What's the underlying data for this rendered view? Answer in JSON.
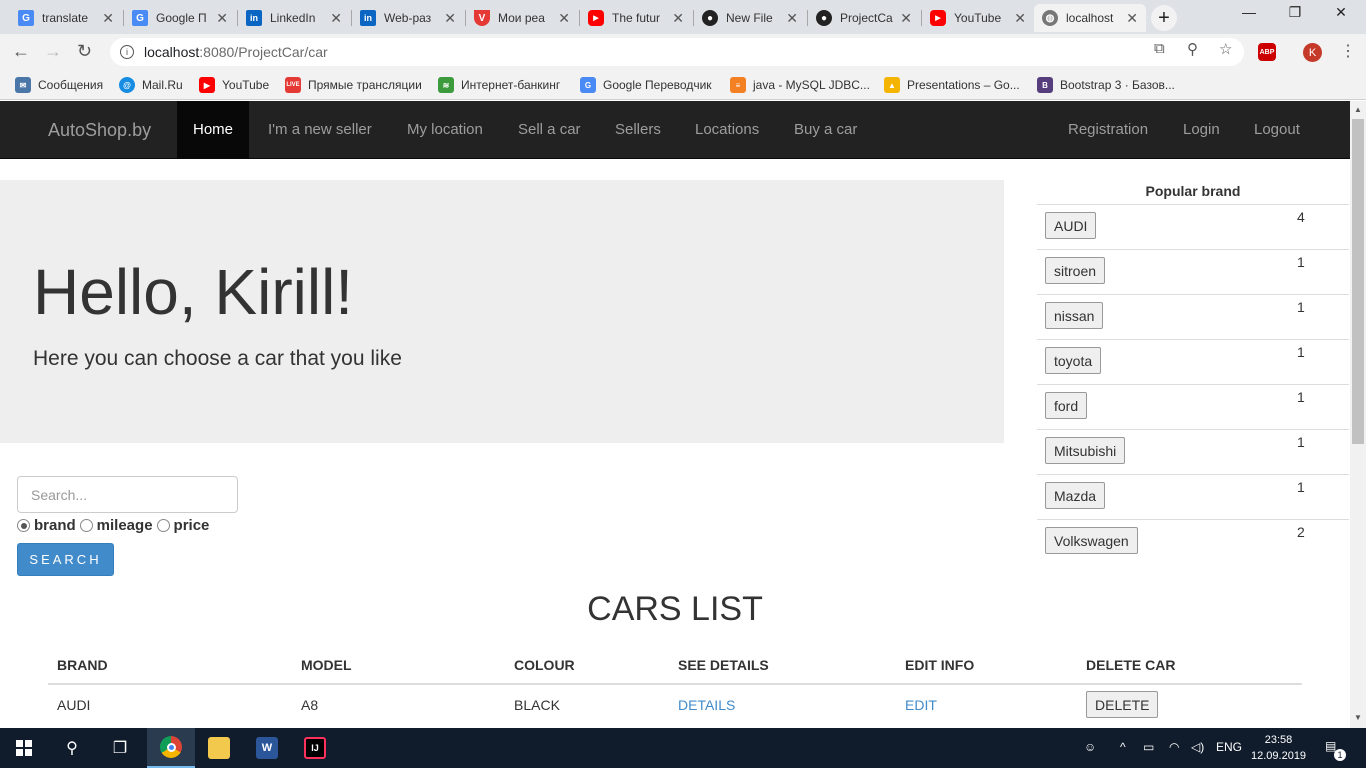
{
  "browser": {
    "tabs": [
      {
        "title": "translate",
        "icon": "google-translate-icon"
      },
      {
        "title": "Google П",
        "icon": "google-translate-icon"
      },
      {
        "title": "LinkedIn",
        "icon": "linkedin-icon"
      },
      {
        "title": "Web-раз",
        "icon": "linkedin-icon"
      },
      {
        "title": "Мои реа",
        "icon": "shield-icon"
      },
      {
        "title": "The futur",
        "icon": "youtube-icon"
      },
      {
        "title": "New File",
        "icon": "github-icon"
      },
      {
        "title": "ProjectCa",
        "icon": "github-icon"
      },
      {
        "title": "YouTube",
        "icon": "youtube-icon"
      },
      {
        "title": "localhost",
        "icon": "globe-icon"
      }
    ],
    "url_host": "localhost",
    "url_path": ":8080/ProjectCar/car",
    "profile_initial": "K",
    "adblock_label": "ABP",
    "bookmarks": [
      {
        "label": "Сообщения",
        "color": "#4a76a8"
      },
      {
        "label": "Mail.Ru",
        "color": "#168de2"
      },
      {
        "label": "YouTube",
        "color": "#ff0000"
      },
      {
        "label": "Прямые трансляции",
        "color": "#e53935"
      },
      {
        "label": "Интернет-банкинг",
        "color": "#3c9b3c"
      },
      {
        "label": "Google Переводчик",
        "color": "#4a8af4"
      },
      {
        "label": "java - MySQL JDBC...",
        "color": "#f48024"
      },
      {
        "label": "Presentations – Go...",
        "color": "#f4b400"
      },
      {
        "label": "Bootstrap 3 · Базов...",
        "color": "#563d7c"
      }
    ]
  },
  "site": {
    "brand": "AutoShop.by",
    "nav": [
      "Home",
      "I'm a new seller",
      "My location",
      "Sell a car",
      "Sellers",
      "Locations",
      "Buy a car"
    ],
    "nav_right": [
      "Registration",
      "Login",
      "Logout"
    ],
    "hero_title": "Hello, Kirill!",
    "hero_subtitle": "Here you can choose a car that you like",
    "popular_title": "Popular brand",
    "popular": [
      {
        "brand": "AUDI",
        "count": "4"
      },
      {
        "brand": "sitroen",
        "count": "1"
      },
      {
        "brand": "nissan",
        "count": "1"
      },
      {
        "brand": "toyota",
        "count": "1"
      },
      {
        "brand": "ford",
        "count": "1"
      },
      {
        "brand": "Mitsubishi",
        "count": "1"
      },
      {
        "brand": "Mazda",
        "count": "1"
      },
      {
        "brand": "Volkswagen",
        "count": "2"
      }
    ],
    "search_placeholder": "Search...",
    "search_options": [
      "brand",
      "mileage",
      "price"
    ],
    "search_selected": "brand",
    "search_button": "SEARCH",
    "list_title": "CARS LIST",
    "table_headers": [
      "BRAND",
      "MODEL",
      "COLOUR",
      "SEE DETAILS",
      "EDIT INFO",
      "DELETE CAR"
    ],
    "rows": [
      {
        "brand": "AUDI",
        "model": "A8",
        "colour": "BLACK",
        "details": "DETAILS",
        "edit": "EDIT",
        "delete": "DELETE"
      }
    ]
  },
  "taskbar": {
    "lang": "ENG",
    "time": "23:58",
    "date": "12.09.2019",
    "notifications": "1"
  }
}
